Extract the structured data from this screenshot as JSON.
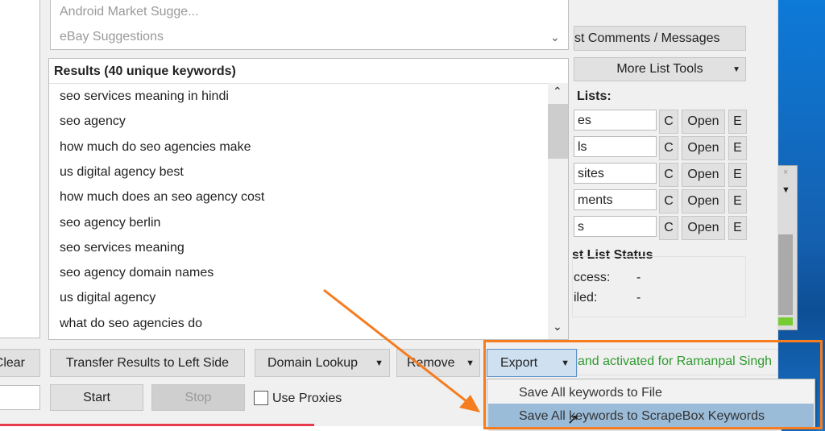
{
  "suggestions": {
    "items": [
      "Android Market Sugge...",
      "eBay Suggestions"
    ]
  },
  "results": {
    "header": "Results (40 unique keywords)",
    "keywords": [
      "seo services meaning in hindi",
      "seo agency",
      "how much do seo agencies make",
      "us digital agency best",
      "how much does an seo agency cost",
      "seo agency berlin",
      "seo services meaning",
      "seo agency domain names",
      "us digital agency",
      "what do seo agencies do"
    ]
  },
  "right_panel": {
    "post_comments": "st Comments / Messages",
    "more_list_tools": "More List Tools",
    "lists_label": "Lists:",
    "lists": [
      "es",
      "ls",
      "sites",
      "ments",
      "s"
    ],
    "c_label": "C",
    "open_label": "Open",
    "e_label": "E",
    "status_title": "st List Status",
    "success_label": "ccess:",
    "success_value": "-",
    "failed_label": "iled:",
    "failed_value": "-"
  },
  "toolbar": {
    "clear": "Clear",
    "transfer": "Transfer Results to Left Side",
    "domain_lookup": "Domain Lookup",
    "remove": "Remove",
    "export": "Export",
    "start": "Start",
    "stop": "Stop",
    "use_proxies": "Use Proxies",
    "license": "and activated for Ramanpal Singh"
  },
  "export_menu": {
    "items": [
      "Save All keywords to File",
      "Save All keywords to ScrapeBox Keywords"
    ]
  },
  "colors": {
    "annotation": "#f57c1f",
    "license_text": "#2e9b2e",
    "desktop": "#1a73c9",
    "menu_highlight": "#9bbcd9"
  }
}
